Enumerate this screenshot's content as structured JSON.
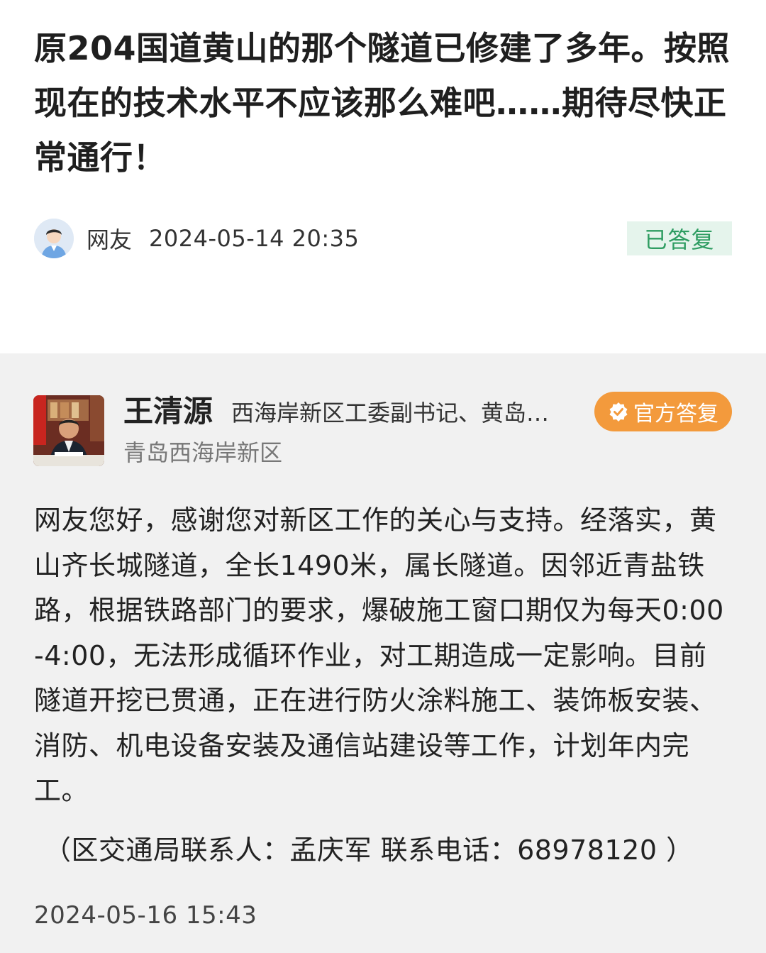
{
  "question": {
    "title": "原204国道黄山的那个隧道已修建了多年。按照现在的技术水平不应该那么难吧……期待尽快正常通行！",
    "author": "网友",
    "posted_at": "2024-05-14 20:35",
    "status": "已答复"
  },
  "answer": {
    "responder_name": "王清源",
    "responder_title": "西海岸新区工委副书记、黄岛…",
    "responder_org": "青岛西海岸新区",
    "official_badge": "官方答复",
    "body": "网友您好，感谢您对新区工作的关心与支持。经落实，黄山齐长城隧道，全长1490米，属长隧道。因邻近青盐铁路，根据铁路部门的要求，爆破施工窗口期仅为每天0:00-4:00，无法形成循环作业，对工期造成一定影响。目前隧道开挖已贯通，正在进行防火涂料施工、装饰板安装、消防、机电设备安装及通信站建设等工作，计划年内完工。",
    "contact": "（区交通局联系人：孟庆军 联系电话：68978120 ）",
    "answered_at": "2024-05-16 15:43"
  },
  "colors": {
    "status_badge_bg": "#e5f4ec",
    "status_badge_text": "#2f9d62",
    "official_badge_bg": "#f39a3c",
    "answer_bg": "#f1f1f1"
  },
  "icons": {
    "user_avatar": "default-user-avatar-icon",
    "official_badge": "verified-check-icon"
  }
}
